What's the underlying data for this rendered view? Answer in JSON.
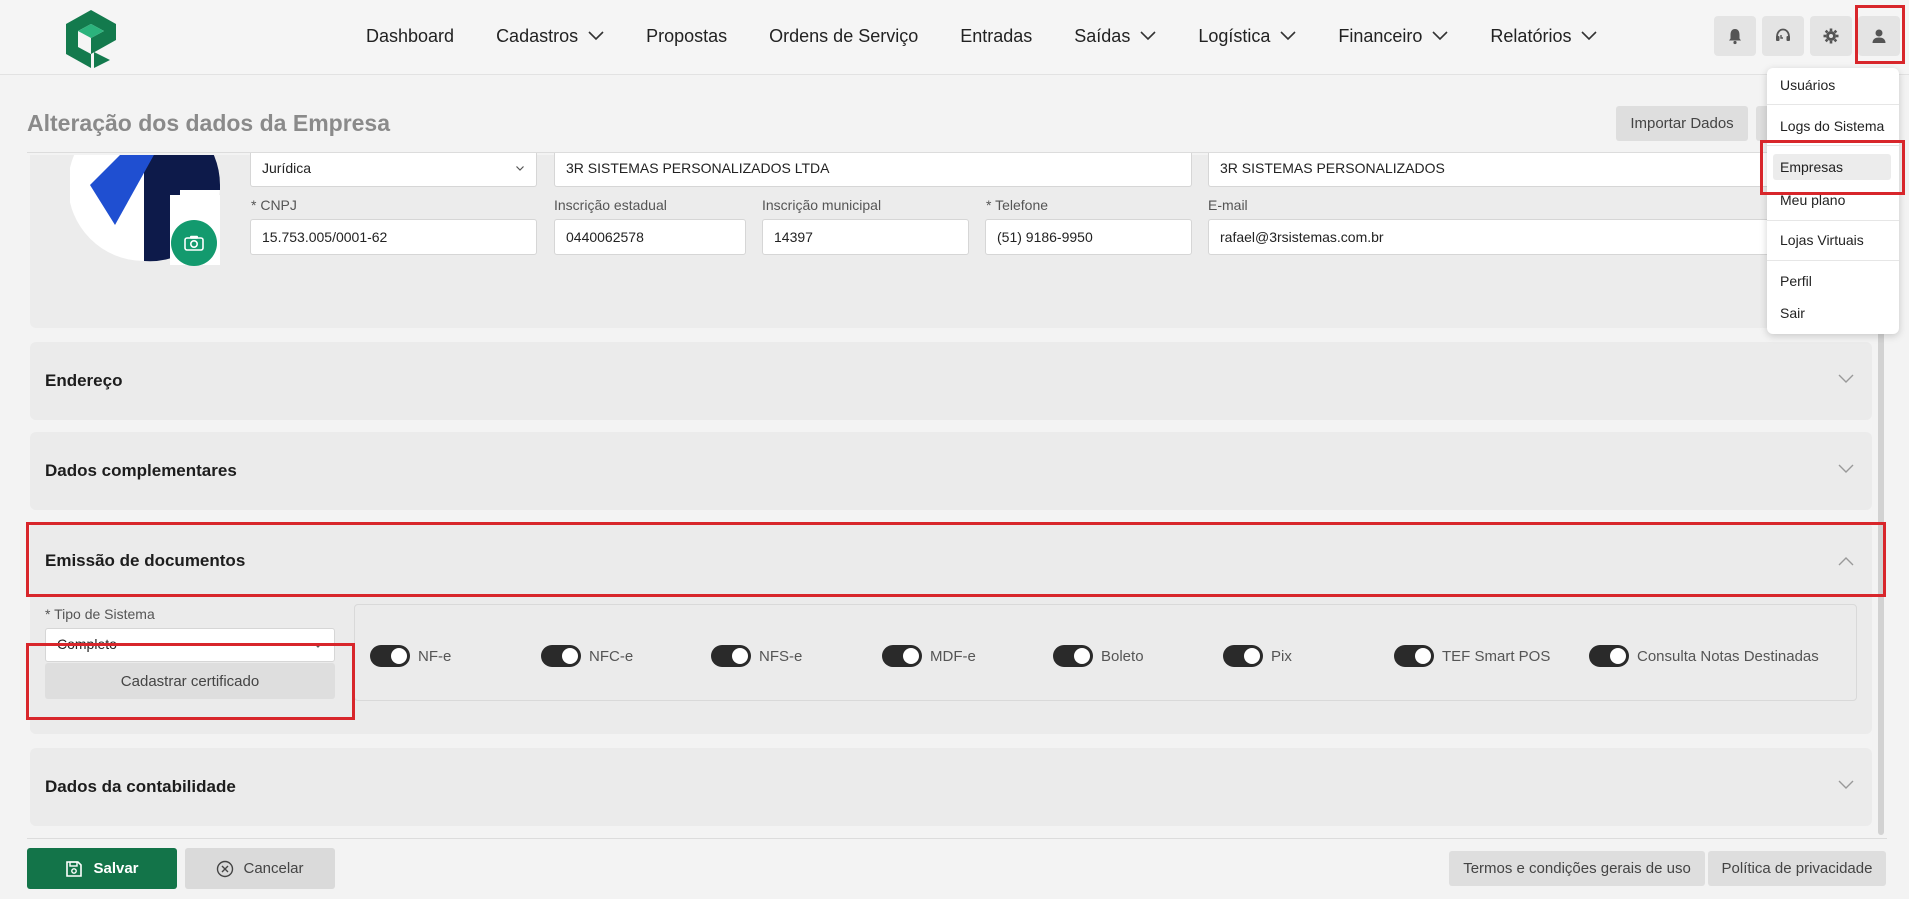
{
  "nav": {
    "items": [
      {
        "label": "Dashboard",
        "has_chevron": false
      },
      {
        "label": "Cadastros",
        "has_chevron": true
      },
      {
        "label": "Propostas",
        "has_chevron": false
      },
      {
        "label": "Ordens de Serviço",
        "has_chevron": false
      },
      {
        "label": "Entradas",
        "has_chevron": false
      },
      {
        "label": "Saídas",
        "has_chevron": true
      },
      {
        "label": "Logística",
        "has_chevron": true
      },
      {
        "label": "Financeiro",
        "has_chevron": true
      },
      {
        "label": "Relatórios",
        "has_chevron": true
      }
    ],
    "icons": [
      "bell-icon",
      "headset-icon",
      "gear-icon",
      "user-icon"
    ]
  },
  "user_menu": {
    "items": [
      "Usuários",
      "Logs do Sistema",
      "Empresas",
      "Meu plano",
      "Lojas Virtuais",
      "Perfil",
      "Sair"
    ],
    "active": "Empresas"
  },
  "page": {
    "title": "Alteração dos dados da Empresa",
    "import_button": "Importar Dados"
  },
  "company": {
    "person_type": "Jurídica",
    "razao_social": "3R SISTEMAS PERSONALIZADOS LTDA",
    "nome_fantasia": "3R SISTEMAS PERSONALIZADOS",
    "cnpj_label": "* CNPJ",
    "cnpj": "15.753.005/0001-62",
    "ie_label": "Inscrição estadual",
    "ie": "0440062578",
    "im_label": "Inscrição municipal",
    "im": "14397",
    "phone_label": "* Telefone",
    "phone": "(51) 9186-9950",
    "email_label": "E-mail",
    "email": "rafael@3rsistemas.com.br"
  },
  "sections": {
    "endereco": "Endereço",
    "complementares": "Dados complementares",
    "emissao": "Emissão de documentos",
    "contabilidade": "Dados da contabilidade"
  },
  "emissao": {
    "tipo_label": "* Tipo de Sistema",
    "tipo_value": "Completo",
    "cert_button": "Cadastrar certificado",
    "toggles": [
      "NF-e",
      "NFC-e",
      "NFS-e",
      "MDF-e",
      "Boleto",
      "Pix",
      "TEF Smart POS",
      "Consulta Notas Destinadas"
    ]
  },
  "footer": {
    "save": "Salvar",
    "cancel": "Cancelar",
    "terms": "Termos e condições gerais de uso",
    "privacy": "Política de privacidade"
  },
  "colors": {
    "primary": "#137449",
    "accent": "#139a6e",
    "highlight": "#d8262b"
  }
}
